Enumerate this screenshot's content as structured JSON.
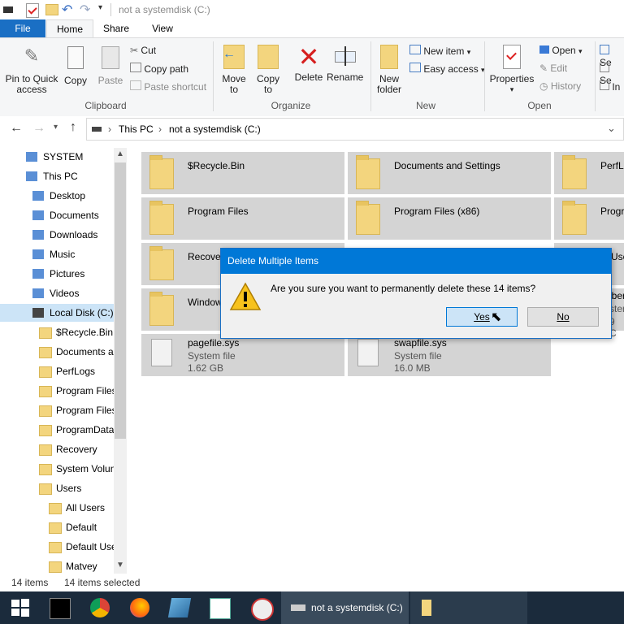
{
  "window": {
    "title": "not a systemdisk (C:)"
  },
  "tabs": {
    "file": "File",
    "home": "Home",
    "share": "Share",
    "view": "View"
  },
  "ribbon": {
    "clipboard": {
      "label": "Clipboard",
      "pin": "Pin to Quick\naccess",
      "copy": "Copy",
      "paste": "Paste",
      "cut": "Cut",
      "copy_path": "Copy path",
      "paste_shortcut": "Paste shortcut"
    },
    "organize": {
      "label": "Organize",
      "move_to": "Move\nto",
      "copy_to": "Copy\nto",
      "delete": "Delete",
      "rename": "Rename"
    },
    "new": {
      "label": "New",
      "new_folder": "New\nfolder",
      "new_item": "New item",
      "easy_access": "Easy access"
    },
    "open": {
      "label": "Open",
      "properties": "Properties",
      "open": "Open",
      "edit": "Edit",
      "history": "History"
    },
    "select": {
      "select_all": "Se",
      "select_none": "Se",
      "invert": "In"
    }
  },
  "address": {
    "this_pc": "This PC",
    "location": "not a systemdisk (C:)"
  },
  "tree": [
    {
      "label": "SYSTEM",
      "indent": 0
    },
    {
      "label": "This PC",
      "indent": 0
    },
    {
      "label": "Desktop",
      "indent": 1
    },
    {
      "label": "Documents",
      "indent": 1
    },
    {
      "label": "Downloads",
      "indent": 1
    },
    {
      "label": "Music",
      "indent": 1
    },
    {
      "label": "Pictures",
      "indent": 1
    },
    {
      "label": "Videos",
      "indent": 1
    },
    {
      "label": "Local Disk (C:)",
      "indent": 1
    },
    {
      "label": "$Recycle.Bin",
      "indent": 2
    },
    {
      "label": "Documents a",
      "indent": 2
    },
    {
      "label": "PerfLogs",
      "indent": 2
    },
    {
      "label": "Program Files",
      "indent": 2
    },
    {
      "label": "Program Files",
      "indent": 2
    },
    {
      "label": "ProgramData",
      "indent": 2
    },
    {
      "label": "Recovery",
      "indent": 2
    },
    {
      "label": "System Volun",
      "indent": 2
    },
    {
      "label": "Users",
      "indent": 2
    },
    {
      "label": "All Users",
      "indent": 3
    },
    {
      "label": "Default",
      "indent": 3
    },
    {
      "label": "Default User",
      "indent": 3
    },
    {
      "label": "Matvey",
      "indent": 3
    }
  ],
  "items": {
    "recycle": "$Recycle.Bin",
    "docs_settings": "Documents and Settings",
    "perflogs": "PerfLo",
    "program_files": "Program Files",
    "program_files_x86": "Program Files (x86)",
    "program_data": "Progr",
    "recovery": "Recover",
    "users": "Users",
    "windows": "Window",
    "hiberfil": "iberf",
    "hiberfil_type": "stem",
    "hiberfil_size": "9 C",
    "pagefile": "pagefile.sys",
    "pagefile_type": "System file",
    "pagefile_size": "1.62 GB",
    "swapfile": "swapfile.sys",
    "swapfile_type": "System file",
    "swapfile_size": "16.0 MB"
  },
  "status": {
    "count": "14 items",
    "selected": "14 items selected"
  },
  "dialog": {
    "title": "Delete Multiple Items",
    "message": "Are you sure you want to permanently delete these 14 items?",
    "yes": "Yes",
    "no": "No"
  },
  "taskbar": {
    "explorer_label": "not a systemdisk (C:)"
  }
}
